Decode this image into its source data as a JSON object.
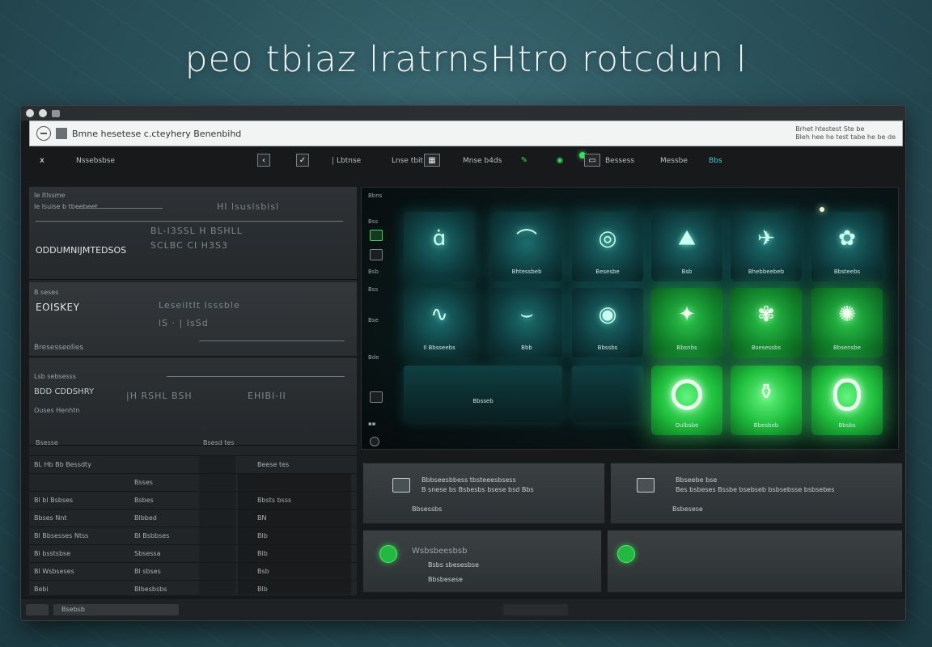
{
  "hero": {
    "title": "peo tbiaz lratrnsHtro rotcdun l"
  },
  "window": {
    "address": {
      "text": "Bmne hesetese c.cteyhery Benenbihd",
      "right_line1": "Brhet htestest Ste be",
      "right_line2": "Bleh hee he test tabe he be de"
    },
    "toolbar": {
      "close_icon": "x",
      "menu_label": "Nssebsbse",
      "item1": "Lbtnse",
      "item2": "Lnse tbit",
      "item3": "Mnse b4ds",
      "item4": "Bessess",
      "item5": "Messbe",
      "item6": "Bbs"
    },
    "left": {
      "s1_header": "Ie ltlssme",
      "s1_sub": "le lsuise b tbeebeet",
      "s1_col1": "HI lsuslsbisl",
      "s1_title": "ODDUMNIJMTEDSOS",
      "s1_rowA": "BL-I3SSL  H  BSHLL",
      "s1_rowB": "SCLBC  CI  H3S3",
      "s2_header": "B seses",
      "s2_title": "EOISKEY",
      "s2_rowA": "LeseiltIt  lsssble",
      "s2_rowB": "lS  ·  |  IsSd",
      "s2_footer": "Bresesseolies",
      "s3_header": "Lsb sebsesss",
      "s3_title": "BDD CDDSHRY",
      "s3_rowA": "|H RSHL BSH",
      "s3_rowB": "EHIBI-II",
      "s3_footer": "Ouses  Henhtn",
      "table_header_left": "Bsesse",
      "table_header_right": "Bsesd tes",
      "rows": [
        {
          "c1": "BL Hb Bb Bessdty",
          "c2": "",
          "c3": "Beese tes"
        },
        {
          "c1": "",
          "c2": "Bsses",
          "c3": ""
        },
        {
          "c1": "Bl bl Bsbses",
          "c2": "Bsbes",
          "c3": "Bbsts bsss"
        },
        {
          "c1": "Bbses  Nnt",
          "c2": "Blbbed",
          "c3": "BN"
        },
        {
          "c1": "Bl Bbsesses Ntss",
          "c2": "Bl Bsbbses",
          "c3": "Blb"
        },
        {
          "c1": "Bl bsstsbse",
          "c2": "Sbsessa",
          "c3": "Blb"
        },
        {
          "c1": "Bl Wsbseses",
          "c2": "Bl sbses",
          "c3": "Bsb"
        },
        {
          "c1": "Bebi",
          "c2": "Blbesbsbs",
          "c3": "Blb"
        }
      ]
    },
    "main": {
      "side_header": "Bbns",
      "side_items": [
        "Bss",
        "Bsb",
        "Bss",
        "Bse",
        "Bde"
      ],
      "tiles_row1": [
        "",
        "Bhtessbeb",
        "Besesbe",
        "Bsb",
        "Bhebbeebeb",
        "Bbsteebs"
      ],
      "tiles_row2": [
        "Il Bbsseebs",
        "Bbb",
        "Bbssbs",
        "Bbsnbs",
        "Bsesessbs",
        "Bbsensbe"
      ],
      "tiles_row3": [
        "Oulbsbe",
        "Bbesbeb",
        "Bbsbs"
      ],
      "wide_label": "Bbsseb"
    },
    "cards": {
      "c1_line1": "Bbbseesbbess tbsteeesbsess",
      "c1_line2": "B snese bs  Bsbesbs  bsese  bsd Bbs",
      "c1_line3": "Bbsessbs",
      "c2_line1": "Bbseebe bse",
      "c2_line2": "Bes bsbeses  Bssbe bsebseb bsbsebsse bsbsebes",
      "c2_line3": "Bsbesese",
      "c3_line1": "Wsbsbeesbsb",
      "c3_line2": "Bsbs sbesesbse",
      "c3_line3": "Bbsbesese"
    },
    "status": {
      "left": "Bsebsb"
    }
  }
}
